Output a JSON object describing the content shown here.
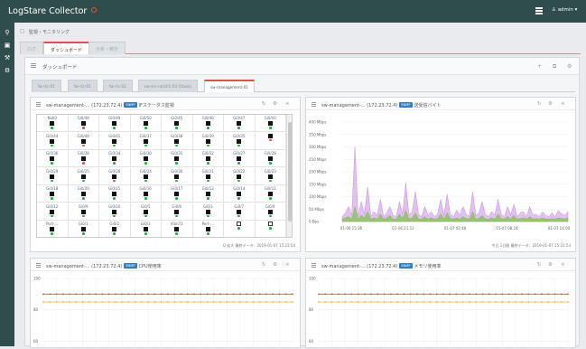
{
  "header": {
    "app_title": "LogStare Collector",
    "user_label": "admin"
  },
  "breadcrumb": "監視・モニタリング",
  "main_tabs": [
    {
      "label": "ログ",
      "active": false
    },
    {
      "label": "ダッシュボード",
      "active": true
    },
    {
      "label": "分析・統計",
      "active": false
    }
  ],
  "dashboard": {
    "title": "ダッシュボード",
    "sub_tabs": [
      {
        "label": "fw-rtc-01",
        "active": false
      },
      {
        "label": "fw-rtc-01",
        "active": false
      },
      {
        "label": "fw-rtc-02",
        "active": false
      },
      {
        "label": "sw-srv-rack01-03 (Stack)",
        "active": false
      },
      {
        "label": "sw-management-01",
        "active": true
      }
    ]
  },
  "panels": [
    {
      "host": "sw-management-... (172.23.72.4)",
      "badge": "SNMP",
      "title": "IFステータス監視",
      "footer": "Q 拡大 最終データ：2019-01-07 15:23:54"
    },
    {
      "host": "sw-management-... (172.23.72.4)",
      "badge": "SNMP",
      "title": "送受信バイト",
      "footer": "今日 1日間 最終データ：2019-01-07 15:23:54"
    },
    {
      "host": "sw-management-... (172.23.72.4)",
      "badge": "SNMP",
      "title": "CPU使用率",
      "footer": ""
    },
    {
      "host": "sw-management-... (172.23.72.4)",
      "badge": "SNMP",
      "title": "メモリ使用率",
      "footer": ""
    }
  ],
  "interfaces": [
    [
      "Null0",
      "Gi0/48",
      "Gi0/49",
      "Gi0/50",
      "Gi0/45",
      "Gi0/46",
      "Gi0/47",
      "Gi0/43"
    ],
    [
      "Gi0/44",
      "Gi0/40",
      "Gi0/41",
      "Gi0/37",
      "Gi0/38",
      "Gi0/39",
      "Gi0/35",
      ""
    ],
    [
      "Gi0/36",
      "Gi0/28",
      "Gi0/34",
      "Gi0/30",
      "Gi0/31",
      "Gi0/32",
      "Gi0/27",
      "Gi0/28"
    ],
    [
      "Gi0/29",
      "Gi0/25",
      "Gi0/26",
      "Gi0/24",
      "Gi0/30",
      "Gi0/21",
      "Gi0/22",
      "Gi0/23"
    ],
    [
      "Gi0/18",
      "Gi0/20",
      "Gi0/15",
      "Gi0/16",
      "Gi0/17",
      "Gi0/13",
      "Gi0/14",
      "Gi0/11"
    ],
    [
      "Gi0/12",
      "Gi0/9",
      "Gi0/10",
      "Gi0/5",
      "Gi0/6",
      "Gi0/3",
      "Gi0/7",
      "Gi0/4"
    ],
    [
      "Port-...",
      "Gi0/1",
      "Gi0/2",
      "Gi0/3",
      "Vlan72",
      "Port-...",
      "",
      ""
    ]
  ],
  "status_colors": {
    "up": "#2aa84a",
    "down": "#d9534f"
  },
  "chart_data": [
    {
      "type": "area",
      "title": "送受信バイト",
      "xlabel": "",
      "ylabel": "",
      "y_ticks": [
        "400 Mbps",
        "350 Mbps",
        "300 Mbps",
        "250 Mbps",
        "200 Mbps",
        "150 Mbps",
        "100 Mbps",
        "50 Mbps",
        "0 Bps"
      ],
      "ylim": [
        0,
        400
      ],
      "x_ticks": [
        "01-06 15:36",
        "01-06 21:12",
        "01-07 02:48",
        "01-07 08:24",
        "01-07 14:00"
      ],
      "series": [
        {
          "name": "",
          "color": "#c98ee0",
          "values": [
            20,
            35,
            60,
            25,
            300,
            20,
            80,
            30,
            140,
            20,
            40,
            25,
            90,
            20,
            35,
            60,
            25,
            20,
            80,
            30,
            155,
            25,
            40,
            120,
            30,
            20,
            60,
            25,
            40,
            20,
            30,
            90,
            25,
            110,
            30,
            20,
            45,
            25,
            60,
            30,
            20,
            120,
            25,
            35,
            80,
            30,
            20,
            40,
            25,
            90,
            30,
            20,
            60,
            25,
            70,
            20,
            35,
            40,
            20,
            60,
            25,
            30,
            20,
            40,
            25,
            20,
            35,
            20,
            45,
            30,
            25,
            40
          ]
        },
        {
          "name": "",
          "color": "#7fc04a",
          "values": [
            10,
            15,
            20,
            10,
            60,
            10,
            25,
            15,
            40,
            10,
            15,
            10,
            30,
            10,
            15,
            25,
            10,
            10,
            30,
            12,
            45,
            10,
            15,
            35,
            10,
            10,
            20,
            10,
            15,
            10,
            12,
            30,
            10,
            35,
            12,
            10,
            15,
            10,
            20,
            12,
            10,
            40,
            10,
            12,
            25,
            10,
            10,
            15,
            10,
            30,
            12,
            10,
            20,
            10,
            25,
            10,
            12,
            15,
            10,
            20,
            10,
            12,
            10,
            15,
            10,
            10,
            12,
            10,
            15,
            12,
            10,
            15
          ]
        }
      ]
    },
    {
      "type": "line",
      "title": "CPU使用率",
      "y_ticks": [
        "100",
        "80",
        "60"
      ],
      "ylim": [
        55,
        100
      ],
      "series": [
        {
          "name": "",
          "color": "#d9534f",
          "values": [
            90,
            90,
            90,
            90,
            90,
            90,
            90,
            90,
            90,
            90,
            90,
            90,
            90,
            90,
            90,
            90,
            90,
            90,
            90,
            90,
            90,
            90,
            90,
            90,
            90,
            90,
            90,
            90,
            90,
            90,
            90,
            90,
            90,
            90,
            90,
            90,
            90,
            90,
            90
          ]
        },
        {
          "name": "",
          "color": "#f0ad4e",
          "values": [
            85,
            85,
            85,
            85,
            85,
            85,
            85,
            85,
            85,
            85,
            85,
            85,
            85,
            85,
            85,
            85,
            85,
            85,
            85,
            85,
            85,
            85,
            85,
            85,
            85,
            85,
            85,
            85,
            85,
            85,
            85,
            85,
            85,
            85,
            85,
            85,
            85,
            85,
            85
          ]
        }
      ]
    },
    {
      "type": "line",
      "title": "メモリ使用率",
      "y_ticks": [
        "100",
        "80",
        "60"
      ],
      "ylim": [
        55,
        100
      ],
      "series": [
        {
          "name": "",
          "color": "#d9534f",
          "values": [
            90,
            90,
            90,
            90,
            90,
            90,
            90,
            90,
            90,
            90,
            90,
            90,
            90,
            90,
            90,
            90,
            90,
            90,
            90,
            90,
            90,
            90,
            90,
            90,
            90,
            90,
            90,
            90,
            90,
            90,
            90,
            90,
            90,
            90,
            90,
            90,
            90,
            90,
            90
          ]
        },
        {
          "name": "",
          "color": "#f0ad4e",
          "values": [
            85,
            85,
            85,
            85,
            85,
            85,
            85,
            85,
            85,
            85,
            85,
            85,
            85,
            85,
            85,
            85,
            85,
            85,
            85,
            85,
            85,
            85,
            85,
            85,
            85,
            85,
            85,
            85,
            85,
            85,
            85,
            85,
            85,
            85,
            85,
            85,
            85,
            85,
            85
          ]
        }
      ]
    }
  ]
}
